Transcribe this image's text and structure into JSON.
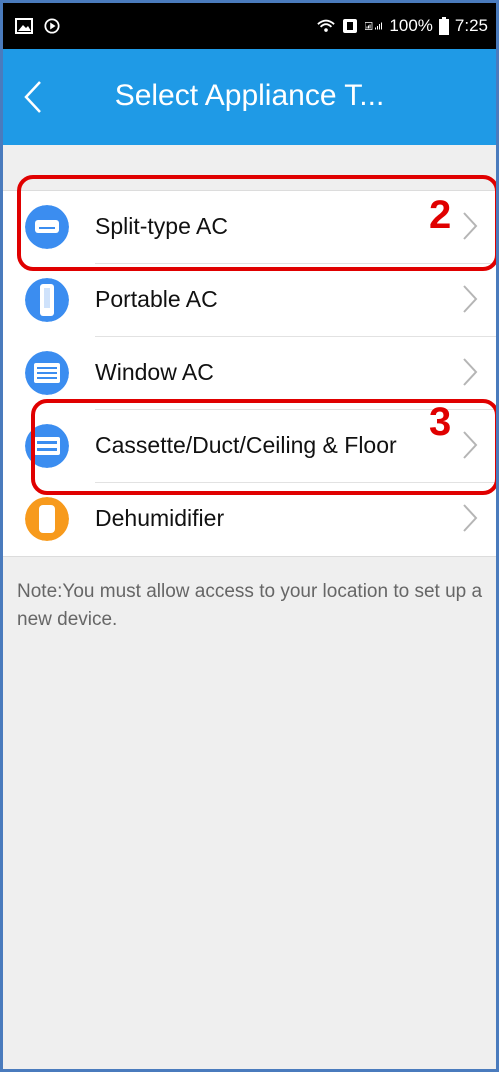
{
  "status_bar": {
    "battery": "100%",
    "time": "7:25",
    "left_icons": [
      "gallery-icon",
      "media-play-icon"
    ],
    "right_icons": [
      "wifi-icon",
      "data-saver-icon",
      "signal-icon"
    ]
  },
  "header": {
    "title": "Select Appliance T...",
    "back_icon": "chevron-left-icon",
    "background": "#1f9ae6"
  },
  "appliances": [
    {
      "label": "Split-type AC",
      "icon": "split-ac-icon",
      "icon_color": "#3b8df0"
    },
    {
      "label": "Portable AC",
      "icon": "portable-ac-icon",
      "icon_color": "#3b8df0"
    },
    {
      "label": "Window AC",
      "icon": "window-ac-icon",
      "icon_color": "#3b8df0"
    },
    {
      "label": "Cassette/Duct/Ceiling & Floor",
      "icon": "cassette-ac-icon",
      "icon_color": "#3b8df0"
    },
    {
      "label": "Dehumidifier",
      "icon": "dehumidifier-icon",
      "icon_color": "#f79a1c"
    }
  ],
  "note": "Note:You must allow access to your location to set up a new device.",
  "annotations": [
    {
      "number": "2",
      "color": "#e00000"
    },
    {
      "number": "3",
      "color": "#e00000"
    }
  ]
}
